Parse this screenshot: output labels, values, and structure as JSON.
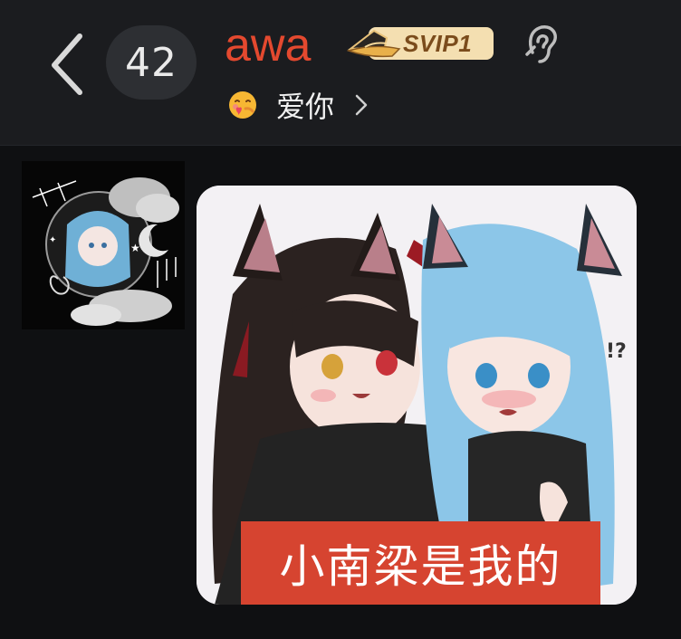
{
  "header": {
    "back_icon": "chevron-left-icon",
    "unread_count": "42",
    "contact_name": "awa",
    "vip_badge": "SVIP1",
    "ear_icon": "ear-icon",
    "status_emoji": "hugging-heart-emoji",
    "status_text": "爱你",
    "status_chevron": "chevron-right-icon"
  },
  "message": {
    "sender_avatar": "avatar-image",
    "image_caption": "小南梁是我的"
  },
  "colors": {
    "name": "#e4492f",
    "svip_pill": "#f4dfb1",
    "caption_bg": "#d64430",
    "header_bg": "#1b1c1f",
    "chat_bg": "#0f1012"
  }
}
